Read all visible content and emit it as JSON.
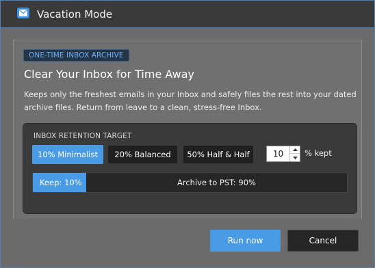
{
  "window": {
    "title": "Vacation Mode",
    "accent": "#4a9be6"
  },
  "intro": {
    "badge": "ONE-TIME INBOX ARCHIVE",
    "heading": "Clear Your Inbox for Time Away",
    "description": "Keeps only the freshest emails in your Inbox and safely files the rest into your dated archive files. Return from leave to a clean, stress-free Inbox."
  },
  "retention": {
    "label": "INBOX RETENTION TARGET",
    "options": [
      {
        "label": "10% Minimalist",
        "selected": true
      },
      {
        "label": "20% Balanced",
        "selected": false
      },
      {
        "label": "50% Half & Half",
        "selected": false
      }
    ],
    "percent_value": "10",
    "percent_unit": "% kept",
    "keep_fraction": 0.17,
    "keep_label": "Keep: 10%",
    "archive_label": "Archive to PST: 90%"
  },
  "actions": {
    "run_label": "Run now",
    "cancel_label": "Cancel"
  }
}
